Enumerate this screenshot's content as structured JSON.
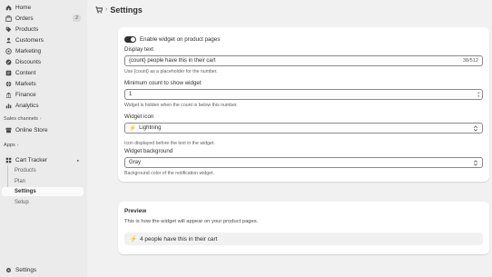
{
  "sidebar": {
    "items": [
      {
        "label": "Home",
        "icon": "home-icon"
      },
      {
        "label": "Orders",
        "icon": "orders-icon",
        "badge": "2"
      },
      {
        "label": "Products",
        "icon": "tag-icon"
      },
      {
        "label": "Customers",
        "icon": "person-icon"
      },
      {
        "label": "Marketing",
        "icon": "target-icon"
      },
      {
        "label": "Discounts",
        "icon": "discount-icon"
      },
      {
        "label": "Content",
        "icon": "content-icon"
      },
      {
        "label": "Markets",
        "icon": "globe-icon"
      },
      {
        "label": "Finance",
        "icon": "bank-icon"
      },
      {
        "label": "Analytics",
        "icon": "chart-icon"
      }
    ],
    "sales_channels_label": "Sales channels",
    "online_store": "Online Store",
    "apps_label": "Apps",
    "app_name": "Cart Tracker",
    "app_sub": [
      "Products",
      "Plan",
      "Settings",
      "Setup"
    ],
    "settings": "Settings"
  },
  "header": {
    "title": "Settings",
    "app_icon": "cart-icon"
  },
  "form": {
    "enable_label": "Enable widget on product pages",
    "enable_on": true,
    "display_text_label": "Display text",
    "display_text_value": "{count} people have this in their cart",
    "display_text_count": "38/512",
    "display_text_help": "Use {count} as a placeholder for the number.",
    "min_count_label": "Minimum count to show widget",
    "min_count_value": "1",
    "min_count_help": "Widget is hidden when the count is below this number.",
    "icon_label": "Widget icon",
    "icon_value": "Lightning",
    "icon_help": "Icon displayed before the text in the widget.",
    "bg_label": "Widget background",
    "bg_value": "Gray",
    "bg_help": "Background color of the notification widget."
  },
  "preview": {
    "title": "Preview",
    "help": "This is how the widget will appear on your product pages.",
    "text": "4 people have this in their cart"
  },
  "colors": {
    "sidebar_bg": "#ebebeb",
    "page_bg": "#f1f1f1",
    "toggle_on": "#303030",
    "bolt": "#c99400"
  }
}
